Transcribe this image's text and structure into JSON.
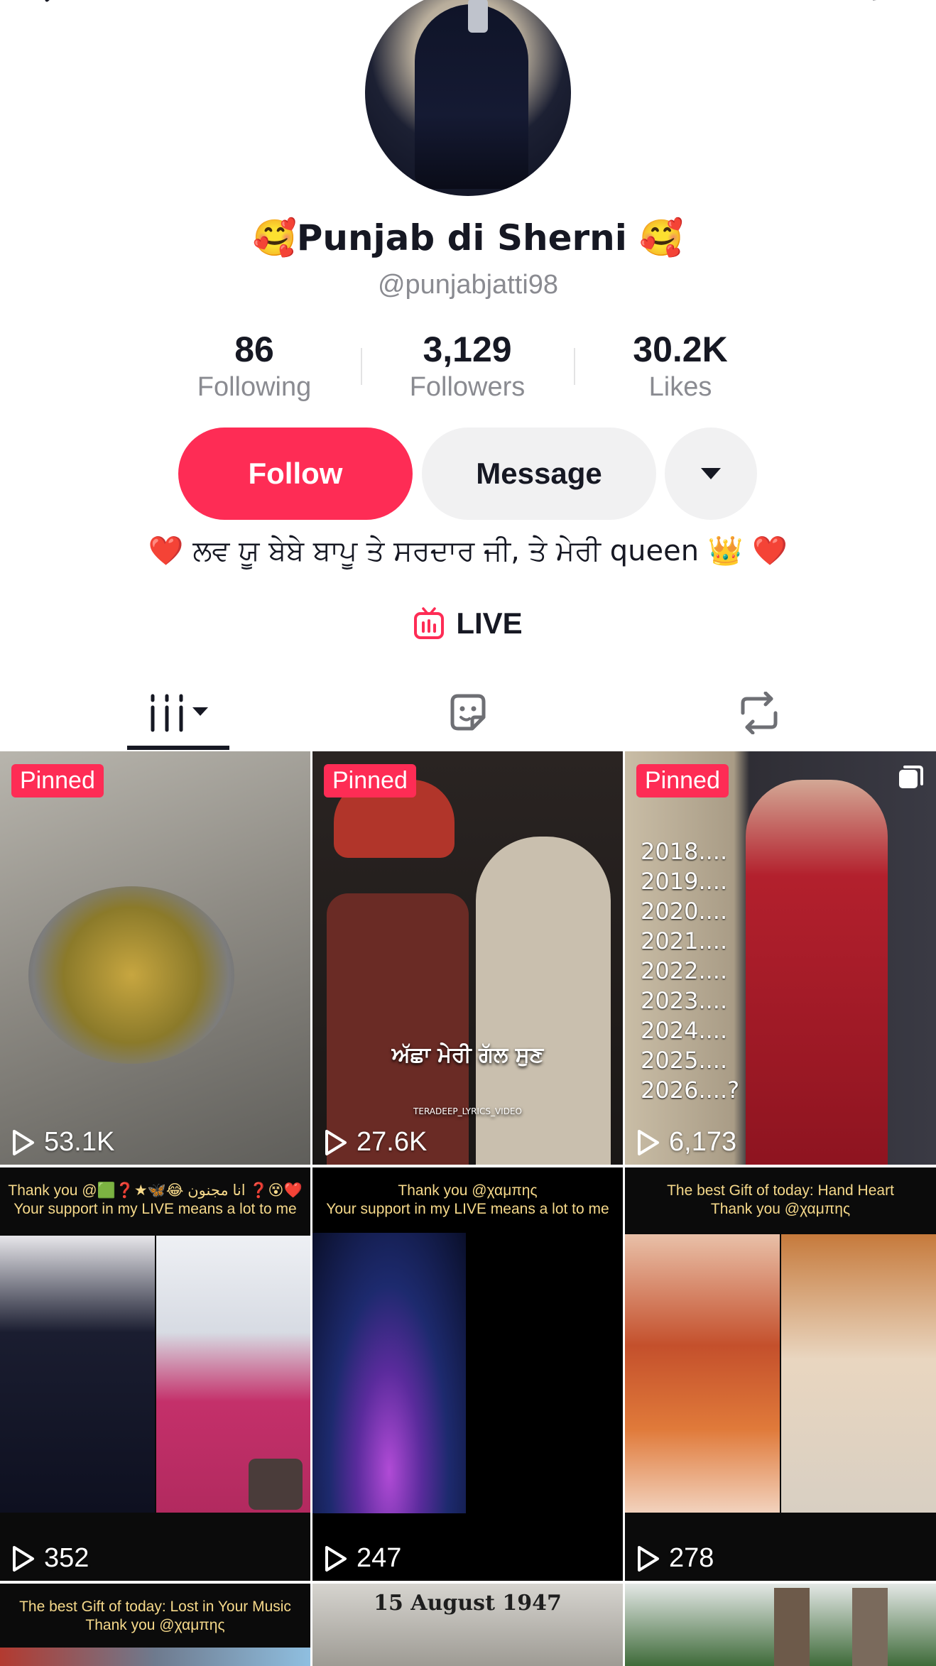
{
  "header": {
    "back_icon": "chevron-left-icon",
    "bell_icon": "bell-icon",
    "share_icon": "share-arrow-icon"
  },
  "profile": {
    "display_name": "🥰Punjab di Sherni 🥰",
    "username": "@punjabjatti98",
    "bio": "❤️ ਲਵ ਯੂ ਬੇਬੇ ਬਾਪੂ ਤੇ ਸਰਦਾਰ ਜੀ, ਤੇ ਮੇਰੀ queen 👑 ❤️",
    "live_label": "LIVE"
  },
  "stats": [
    {
      "value": "86",
      "label": "Following"
    },
    {
      "value": "3,129",
      "label": "Followers"
    },
    {
      "value": "30.2K",
      "label": "Likes"
    }
  ],
  "actions": {
    "follow_label": "Follow",
    "message_label": "Message"
  },
  "tabs": [
    {
      "icon": "videos-grid-icon",
      "selected": true
    },
    {
      "icon": "sticker-icon",
      "selected": false
    },
    {
      "icon": "repost-icon",
      "selected": false
    }
  ],
  "videos": [
    {
      "pinned_label": "Pinned",
      "plays": "53.1K"
    },
    {
      "pinned_label": "Pinned",
      "plays": "27.6K",
      "overlay": "ਅੱਛਾ ਮੇਰੀ ਗੱਲ ਸੁਣ",
      "credit": "TERADEEP_LYRICS_VIDEO"
    },
    {
      "pinned_label": "Pinned",
      "plays": "6,173",
      "years": [
        "2018....",
        "2019....",
        "2020....",
        "2021....",
        "2022....",
        "2023....",
        "2024....",
        "2025....",
        "2026....?"
      ]
    },
    {
      "plays": "352",
      "caption_1": "Thank you @🟩❓★🦋😂 انا مجنون ❓😵❤️",
      "caption_2": "Your support in my LIVE means a lot to me"
    },
    {
      "plays": "247",
      "caption_1": "Thank you @χαμπης",
      "caption_2": "Your support in my LIVE means a lot to me"
    },
    {
      "plays": "278",
      "caption_1": "The best Gift of today: Hand Heart",
      "caption_2": "Thank you @χαμπης"
    },
    {
      "caption_1": "The best Gift of today: Lost in Your Music",
      "caption_2": "Thank you @χαμπης"
    },
    {
      "overlay": "15 August 1947"
    },
    {}
  ],
  "colors": {
    "accent": "#fe2c55",
    "text_primary": "#161823",
    "text_secondary": "#8a8b91",
    "button_gray": "#f1f1f2"
  }
}
